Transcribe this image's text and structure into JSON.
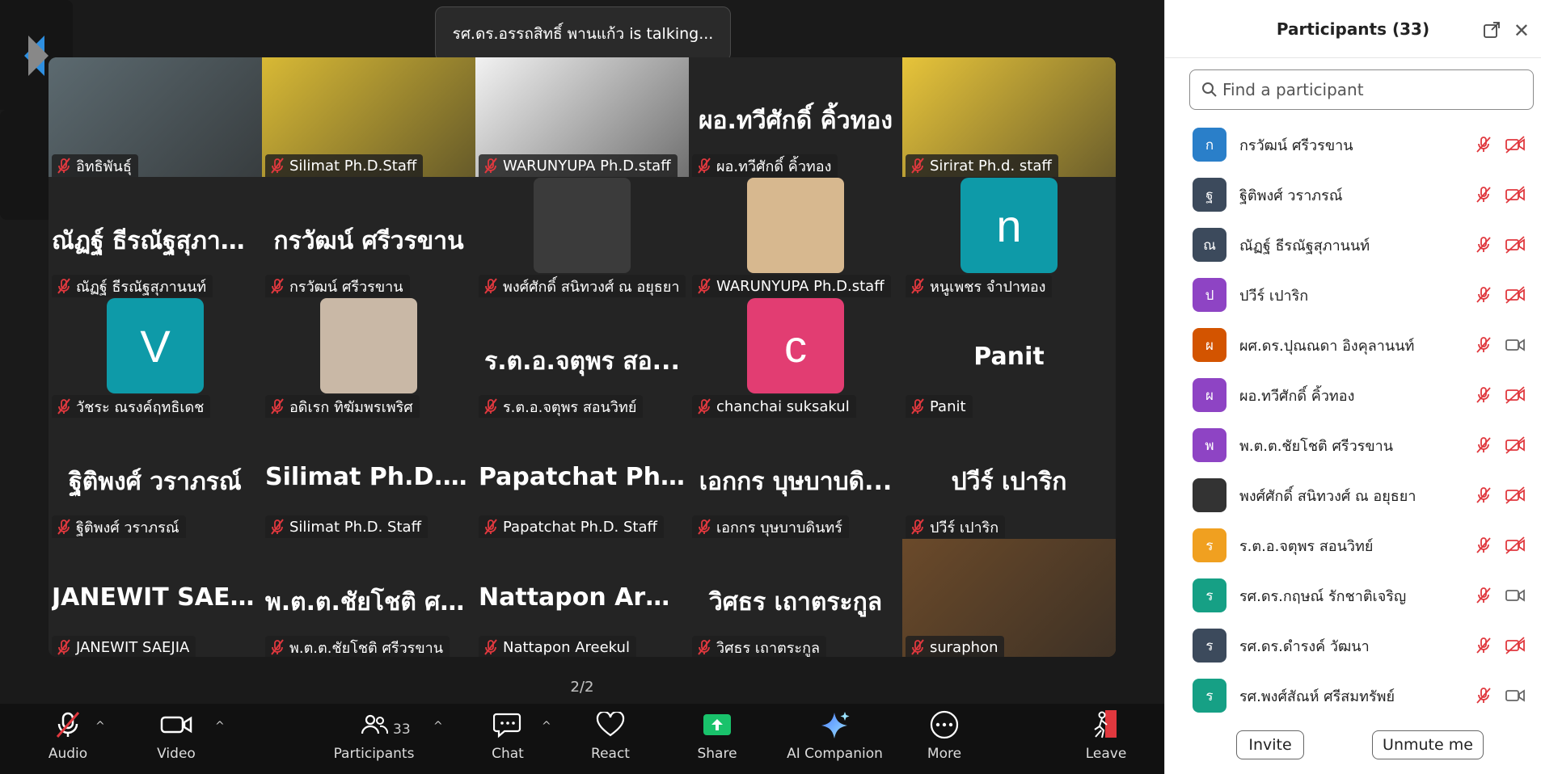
{
  "banner": {
    "talking": "รศ.ดร.อรรถสิทธิ์ พานแก้ว is talking..."
  },
  "pager": {
    "left_count": "2/2",
    "right_count": "2/2"
  },
  "tiles": [
    {
      "big": "",
      "name": "อิทธิพันธุ์",
      "type": "video",
      "bg": "#5c6a70"
    },
    {
      "big": "",
      "name": "Silimat Ph.D.Staff",
      "type": "video",
      "bg": "#d8b935"
    },
    {
      "big": "",
      "name": "WARUNYUPA Ph.D.staff",
      "type": "video",
      "bg": "#f2f2f2"
    },
    {
      "big": "ผอ.ทวีศักดิ์ คิ้วทอง",
      "name": "ผอ.ทวีศักดิ์ คิ้วทอง",
      "type": "text"
    },
    {
      "big": "",
      "name": "Sirirat Ph.d. staff",
      "type": "video",
      "bg": "#e7c43a"
    },
    {
      "big": "ณัฏฐ์ ธีรณัฐสุภาน...",
      "name": "ณัฏฐ์ ธีรณัฐสุภานนท์",
      "type": "text"
    },
    {
      "big": "กรวัฒน์ ศรีวรขาน",
      "name": "กรวัฒน์ ศรีวรขาน",
      "type": "text"
    },
    {
      "big": "",
      "name": "พงศ์ศักดิ์ สนิทวงศ์ ณ อยุธยา",
      "type": "photo",
      "bg": "#3b3b3b"
    },
    {
      "big": "",
      "name": "WARUNYUPA Ph.D.staff",
      "type": "photo",
      "bg": "#d7b88f"
    },
    {
      "big": "",
      "name": "หนูเพชร จำปาทอง",
      "type": "avatar",
      "letter": "n",
      "bg": "#0e9aa8"
    },
    {
      "big": "",
      "name": "วัชระ ณรงค์ฤทธิเดช",
      "type": "avatar",
      "letter": "V",
      "bg": "#0e9aa8"
    },
    {
      "big": "",
      "name": "อดิเรก ทิฆัมพรเพริศ",
      "type": "photo",
      "bg": "#c9b8a6"
    },
    {
      "big": "ร.ต.อ.จตุพร สอ...",
      "name": "ร.ต.อ.จตุพร สอนวิทย์",
      "type": "text"
    },
    {
      "big": "",
      "name": "chanchai suksakul",
      "type": "avatar",
      "letter": "c",
      "bg": "#e23d72"
    },
    {
      "big": "Panit",
      "name": "Panit",
      "type": "text"
    },
    {
      "big": "ฐิติพงศ์ วราภรณ์",
      "name": "ฐิติพงศ์ วราภรณ์",
      "type": "text"
    },
    {
      "big": "Silimat Ph.D. St...",
      "name": "Silimat Ph.D. Staff",
      "type": "text"
    },
    {
      "big": "Papatchat Ph.D....",
      "name": "Papatchat Ph.D. Staff",
      "type": "text"
    },
    {
      "big": "เอกกร บุษบาบดิ...",
      "name": "เอกกร บุษบาบดินทร์",
      "type": "text"
    },
    {
      "big": "ปวีร์ เปาริก",
      "name": "ปวีร์ เปาริก",
      "type": "text"
    },
    {
      "big": "JANEWIT SAEJIA",
      "name": "JANEWIT SAEJIA",
      "type": "text"
    },
    {
      "big": "พ.ต.ต.ชัยโชติ ศรี...",
      "name": "พ.ต.ต.ชัยโชติ ศรีวรขาน",
      "type": "text"
    },
    {
      "big": "Nattapon Areekul",
      "name": "Nattapon Areekul",
      "type": "text"
    },
    {
      "big": "วิศธร เถาตระกูล",
      "name": "วิศธร เถาตระกูล",
      "type": "text"
    },
    {
      "big": "",
      "name": "suraphon",
      "type": "video",
      "bg": "#6b4a2a"
    }
  ],
  "toolbar": {
    "audio": "Audio",
    "video": "Video",
    "participants": "Participants",
    "participants_count": "33",
    "chat": "Chat",
    "react": "React",
    "share": "Share",
    "ai": "AI Companion",
    "more": "More",
    "leave": "Leave"
  },
  "panel": {
    "title": "Participants (33)",
    "search_placeholder": "Find a participant",
    "invite": "Invite",
    "unmute": "Unmute me",
    "participants": [
      {
        "initial": "ก",
        "name": "กรวัฒน์ ศรีวรขาน",
        "color": "#2a7fc9",
        "cam": "off"
      },
      {
        "initial": "ฐ",
        "name": "ฐิติพงศ์ วราภรณ์",
        "color": "#3c4a5c",
        "cam": "off"
      },
      {
        "initial": "ณ",
        "name": "ณัฏฐ์ ธีรณัฐสุภานนท์",
        "color": "#3c4a5c",
        "cam": "off"
      },
      {
        "initial": "ป",
        "name": "ปวีร์ เปาริก",
        "color": "#8e44c4",
        "cam": "off"
      },
      {
        "initial": "ผ",
        "name": "ผศ.ดร.ปุณณดา อิงคุลานนท์",
        "color": "#d35400",
        "cam": "on"
      },
      {
        "initial": "ผ",
        "name": "ผอ.ทวีศักดิ์ คิ้วทอง",
        "color": "#8e44c4",
        "cam": "off"
      },
      {
        "initial": "พ",
        "name": "พ.ต.ต.ชัยโชติ ศรีวรขาน",
        "color": "#8e44c4",
        "cam": "off"
      },
      {
        "initial": "",
        "name": "พงศ์ศักดิ์ สนิทวงศ์ ณ อยุธยา",
        "color": "#333333",
        "cam": "off"
      },
      {
        "initial": "ร",
        "name": "ร.ต.อ.จตุพร สอนวิทย์",
        "color": "#f0a020",
        "cam": "off"
      },
      {
        "initial": "ร",
        "name": "รศ.ดร.กฤษณ์ รักชาติเจริญ",
        "color": "#16a085",
        "cam": "on"
      },
      {
        "initial": "ร",
        "name": "รศ.ดร.ดำรงค์ วัฒนา",
        "color": "#3c4a5c",
        "cam": "off"
      },
      {
        "initial": "ร",
        "name": "รศ.พงศ์สัณห์ ศรีสมทรัพย์",
        "color": "#16a085",
        "cam": "on"
      }
    ]
  }
}
